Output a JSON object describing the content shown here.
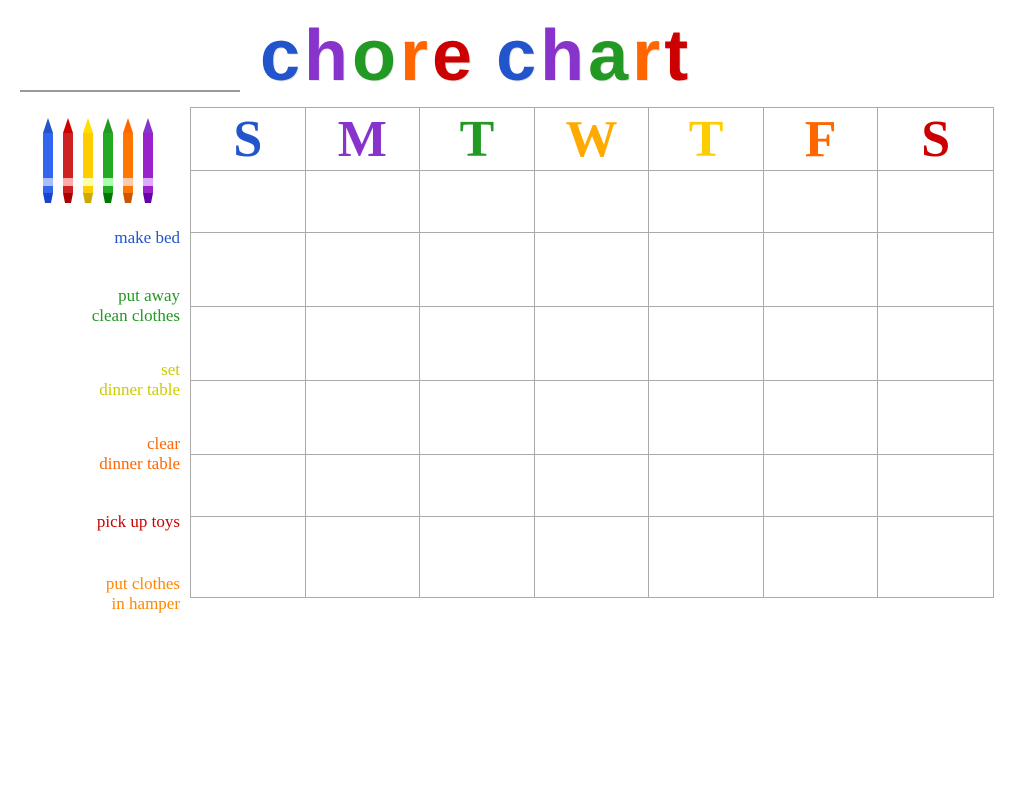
{
  "header": {
    "title_letters": [
      {
        "char": "c",
        "class": "t-c"
      },
      {
        "char": "h",
        "class": "t-h"
      },
      {
        "char": "o",
        "class": "t-o"
      },
      {
        "char": "r",
        "class": "t-r"
      },
      {
        "char": "e",
        "class": "t-e"
      },
      {
        "char": " ",
        "class": "t-sp"
      },
      {
        "char": "c",
        "class": "t-c2"
      },
      {
        "char": "h",
        "class": "t-h2"
      },
      {
        "char": "a",
        "class": "t-a"
      },
      {
        "char": "r",
        "class": "t-r2"
      },
      {
        "char": "t",
        "class": "t-t2"
      }
    ]
  },
  "days": [
    {
      "label": "S",
      "class": "day-s1"
    },
    {
      "label": "M",
      "class": "day-m"
    },
    {
      "label": "T",
      "class": "day-t1"
    },
    {
      "label": "W",
      "class": "day-w"
    },
    {
      "label": "T",
      "class": "day-t2"
    },
    {
      "label": "F",
      "class": "day-f"
    },
    {
      "label": "S",
      "class": "day-s2"
    }
  ],
  "chores": [
    {
      "label": "make bed",
      "color": "#2255cc",
      "multiline": false
    },
    {
      "label": "put away\nclean clothes",
      "color": "#229922",
      "multiline": true
    },
    {
      "label": "set\ndinner table",
      "color": "#cccc00",
      "multiline": true
    },
    {
      "label": "clear\ndinner table",
      "color": "#ff6600",
      "multiline": true
    },
    {
      "label": "pick up toys",
      "color": "#cc0000",
      "multiline": false
    },
    {
      "label": "put clothes\nin hamper",
      "color": "#ff8800",
      "multiline": true
    }
  ]
}
